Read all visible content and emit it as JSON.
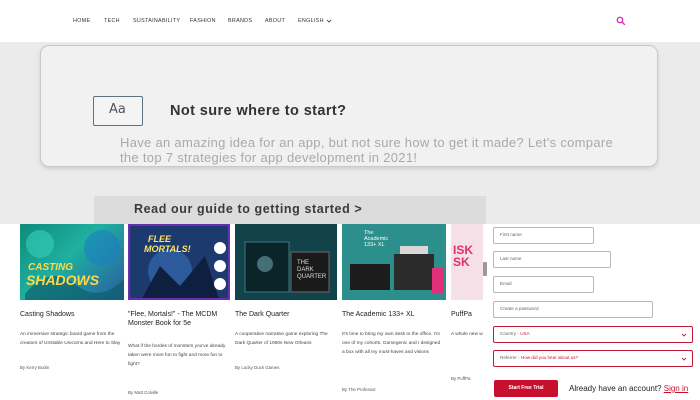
{
  "nav": {
    "items": [
      "HOME",
      "TECH",
      "SUSTAINABILITY",
      "FASHION",
      "BRANDS",
      "ABOUT",
      "ENGLISH"
    ],
    "chevron_icon": "chevron-down-icon",
    "search_icon": "search-icon",
    "accent_color": "#d020b0"
  },
  "promo": {
    "icon_text": "Aa",
    "title": "Not sure where to start?",
    "body": "Have an amazing idea for an app, but not sure how to get it made? Let's compare the top 7 strategies for app development in 2021!",
    "cta": "Read our guide to getting started >"
  },
  "cards": [
    {
      "title": "Casting Shadows",
      "image_text": [
        "CASTING",
        "SHADOWS"
      ],
      "description": "An immersive strategic board game from the creators of Unstable Unicorns and Here to Slay",
      "author": "By Kerry Bodin"
    },
    {
      "title": "\"Flee, Mortals!\" - The MCDM Monster Book for 5e",
      "image_text": [
        "FLEE",
        "MORTALS!"
      ],
      "description": "What if the hordes of monsters you've already taken were more fun to fight and more fun to fight?",
      "author": "By Matt Colville"
    },
    {
      "title": "The Dark Quarter",
      "image_text": [
        "THE",
        "DARK",
        "QUARTER"
      ],
      "description": "A cooperative narrative game exploring The Dark Quarter of 1980s New Orleans",
      "author": "By Lucky Duck Games"
    },
    {
      "title": "The Academic 133+ XL",
      "image_text": [
        "The",
        "Academic",
        "133+ XL"
      ],
      "description": "It's time to bring my own desk to the office. I'm one of my cohorts. Gamegenic and I designed a box with all my must-haves and visions",
      "author": "By The Professor"
    },
    {
      "title": "PuffPa",
      "image_text": [
        "ISK",
        "SK"
      ],
      "description": "A whole new way to never...",
      "author": "By PuffPa"
    }
  ],
  "form": {
    "first_name": "First name",
    "last_name": "Last name",
    "email": "Email",
    "password": "Create a password",
    "country_label": "Country -",
    "country_value": "USA",
    "referral_label": "Referrer -",
    "referral_value": "How did you hear about us?",
    "submit": "Start Free Trial",
    "have_account": "Already have an account? ",
    "signin": "Sign in",
    "brand_color": "#c8102e"
  }
}
